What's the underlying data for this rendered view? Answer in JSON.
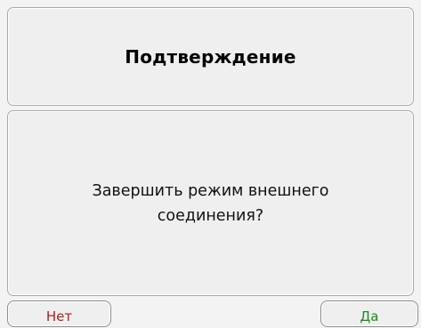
{
  "dialog": {
    "title": "Подтверждение",
    "message": "Завершить режим внешнего соединения?"
  },
  "buttons": {
    "no_label": "Нет",
    "yes_label": "Да"
  },
  "colors": {
    "background": "#f3f3f3",
    "no_text": "#b02020",
    "yes_text": "#1f8a1f"
  }
}
